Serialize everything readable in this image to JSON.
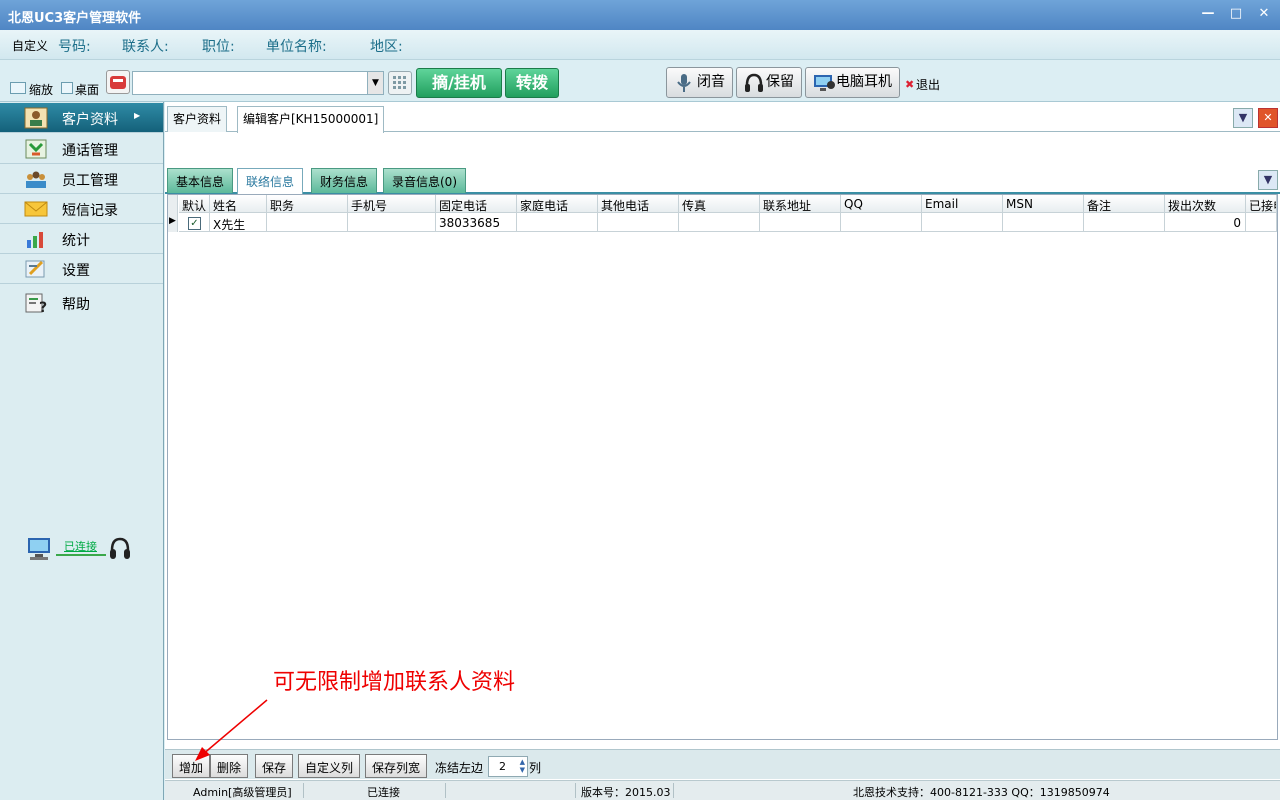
{
  "window": {
    "title": "北恩UC3客户管理软件",
    "minimize": "—",
    "maximize": "□",
    "close": "✕"
  },
  "infobar": {
    "custom": "自定义",
    "number_label": "号码:",
    "contact_label": "联系人:",
    "position_label": "职位:",
    "company_label": "单位名称:",
    "region_label": "地区:"
  },
  "toolbar": {
    "shrink_label": "缩放",
    "desktop_label": "桌面",
    "combo_value": "",
    "pickup_label": "摘/挂机",
    "transfer_label": "转拨",
    "mute_label": "闭音",
    "hold_label": "保留",
    "pc_headset_label": "电脑耳机",
    "exit_label": "退出"
  },
  "sidebar": {
    "items": [
      {
        "label": "客户资料",
        "icon": "customer-icon"
      },
      {
        "label": "通话管理",
        "icon": "call-icon"
      },
      {
        "label": "员工管理",
        "icon": "staff-icon"
      },
      {
        "label": "短信记录",
        "icon": "envelope-icon"
      },
      {
        "label": "统计",
        "icon": "bar-chart-icon"
      },
      {
        "label": "设置",
        "icon": "settings-icon"
      },
      {
        "label": "帮助",
        "icon": "help-icon"
      }
    ],
    "connection_status": "已连接"
  },
  "doc_tabs": [
    "客户资料",
    "编辑客户[KH15000001]"
  ],
  "sub_tabs": [
    "基本信息",
    "联络信息",
    "财务信息",
    "录音信息(0)"
  ],
  "grid": {
    "columns": [
      "默认",
      "姓名",
      "职务",
      "手机号",
      "固定电话",
      "家庭电话",
      "其他电话",
      "传真",
      "联系地址",
      "QQ",
      "Email",
      "MSN",
      "备注",
      "拨出次数",
      "已接电"
    ],
    "rows": [
      {
        "default": "✓",
        "name": "X先生",
        "title": "",
        "mobile": "",
        "phone": "38033685",
        "home": "",
        "other": "",
        "fax": "",
        "address": "",
        "qq": "",
        "email": "",
        "msn": "",
        "note": "",
        "dial_count": "0",
        "answered": ""
      }
    ]
  },
  "bottombar": {
    "add": "增加",
    "delete": "删除",
    "save": "保存",
    "custom_cols": "自定义列",
    "save_widths": "保存列宽",
    "freeze_label": "冻结左边",
    "freeze_value": "2",
    "freeze_unit": "列"
  },
  "status": {
    "user": "Admin[高级管理员]",
    "connection": "已连接",
    "version": "版本号：2015.03",
    "support": "北恩技术支持：400-8121-333 QQ：1319850974"
  },
  "annotation": "可无限制增加联系人资料"
}
